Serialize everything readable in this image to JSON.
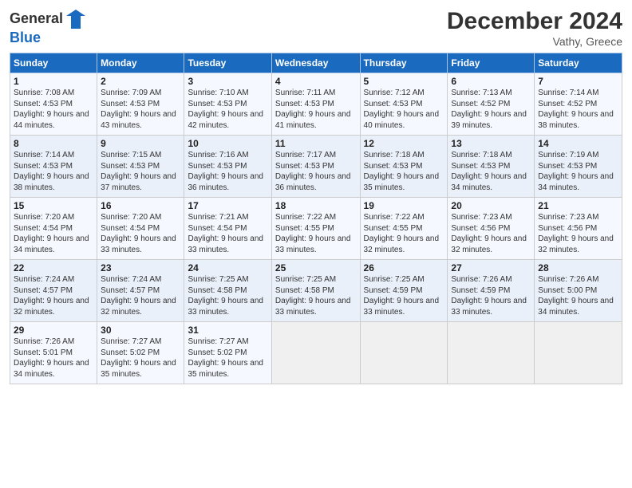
{
  "header": {
    "logo_line1": "General",
    "logo_line2": "Blue",
    "month_title": "December 2024",
    "location": "Vathy, Greece"
  },
  "weekdays": [
    "Sunday",
    "Monday",
    "Tuesday",
    "Wednesday",
    "Thursday",
    "Friday",
    "Saturday"
  ],
  "weeks": [
    [
      {
        "day": "1",
        "detail": "Sunrise: 7:08 AM\nSunset: 4:53 PM\nDaylight: 9 hours\nand 44 minutes."
      },
      {
        "day": "2",
        "detail": "Sunrise: 7:09 AM\nSunset: 4:53 PM\nDaylight: 9 hours\nand 43 minutes."
      },
      {
        "day": "3",
        "detail": "Sunrise: 7:10 AM\nSunset: 4:53 PM\nDaylight: 9 hours\nand 42 minutes."
      },
      {
        "day": "4",
        "detail": "Sunrise: 7:11 AM\nSunset: 4:53 PM\nDaylight: 9 hours\nand 41 minutes."
      },
      {
        "day": "5",
        "detail": "Sunrise: 7:12 AM\nSunset: 4:53 PM\nDaylight: 9 hours\nand 40 minutes."
      },
      {
        "day": "6",
        "detail": "Sunrise: 7:13 AM\nSunset: 4:52 PM\nDaylight: 9 hours\nand 39 minutes."
      },
      {
        "day": "7",
        "detail": "Sunrise: 7:14 AM\nSunset: 4:52 PM\nDaylight: 9 hours\nand 38 minutes."
      }
    ],
    [
      {
        "day": "8",
        "detail": "Sunrise: 7:14 AM\nSunset: 4:53 PM\nDaylight: 9 hours\nand 38 minutes."
      },
      {
        "day": "9",
        "detail": "Sunrise: 7:15 AM\nSunset: 4:53 PM\nDaylight: 9 hours\nand 37 minutes."
      },
      {
        "day": "10",
        "detail": "Sunrise: 7:16 AM\nSunset: 4:53 PM\nDaylight: 9 hours\nand 36 minutes."
      },
      {
        "day": "11",
        "detail": "Sunrise: 7:17 AM\nSunset: 4:53 PM\nDaylight: 9 hours\nand 36 minutes."
      },
      {
        "day": "12",
        "detail": "Sunrise: 7:18 AM\nSunset: 4:53 PM\nDaylight: 9 hours\nand 35 minutes."
      },
      {
        "day": "13",
        "detail": "Sunrise: 7:18 AM\nSunset: 4:53 PM\nDaylight: 9 hours\nand 34 minutes."
      },
      {
        "day": "14",
        "detail": "Sunrise: 7:19 AM\nSunset: 4:53 PM\nDaylight: 9 hours\nand 34 minutes."
      }
    ],
    [
      {
        "day": "15",
        "detail": "Sunrise: 7:20 AM\nSunset: 4:54 PM\nDaylight: 9 hours\nand 34 minutes."
      },
      {
        "day": "16",
        "detail": "Sunrise: 7:20 AM\nSunset: 4:54 PM\nDaylight: 9 hours\nand 33 minutes."
      },
      {
        "day": "17",
        "detail": "Sunrise: 7:21 AM\nSunset: 4:54 PM\nDaylight: 9 hours\nand 33 minutes."
      },
      {
        "day": "18",
        "detail": "Sunrise: 7:22 AM\nSunset: 4:55 PM\nDaylight: 9 hours\nand 33 minutes."
      },
      {
        "day": "19",
        "detail": "Sunrise: 7:22 AM\nSunset: 4:55 PM\nDaylight: 9 hours\nand 32 minutes."
      },
      {
        "day": "20",
        "detail": "Sunrise: 7:23 AM\nSunset: 4:56 PM\nDaylight: 9 hours\nand 32 minutes."
      },
      {
        "day": "21",
        "detail": "Sunrise: 7:23 AM\nSunset: 4:56 PM\nDaylight: 9 hours\nand 32 minutes."
      }
    ],
    [
      {
        "day": "22",
        "detail": "Sunrise: 7:24 AM\nSunset: 4:57 PM\nDaylight: 9 hours\nand 32 minutes."
      },
      {
        "day": "23",
        "detail": "Sunrise: 7:24 AM\nSunset: 4:57 PM\nDaylight: 9 hours\nand 32 minutes."
      },
      {
        "day": "24",
        "detail": "Sunrise: 7:25 AM\nSunset: 4:58 PM\nDaylight: 9 hours\nand 33 minutes."
      },
      {
        "day": "25",
        "detail": "Sunrise: 7:25 AM\nSunset: 4:58 PM\nDaylight: 9 hours\nand 33 minutes."
      },
      {
        "day": "26",
        "detail": "Sunrise: 7:25 AM\nSunset: 4:59 PM\nDaylight: 9 hours\nand 33 minutes."
      },
      {
        "day": "27",
        "detail": "Sunrise: 7:26 AM\nSunset: 4:59 PM\nDaylight: 9 hours\nand 33 minutes."
      },
      {
        "day": "28",
        "detail": "Sunrise: 7:26 AM\nSunset: 5:00 PM\nDaylight: 9 hours\nand 34 minutes."
      }
    ],
    [
      {
        "day": "29",
        "detail": "Sunrise: 7:26 AM\nSunset: 5:01 PM\nDaylight: 9 hours\nand 34 minutes."
      },
      {
        "day": "30",
        "detail": "Sunrise: 7:27 AM\nSunset: 5:02 PM\nDaylight: 9 hours\nand 35 minutes."
      },
      {
        "day": "31",
        "detail": "Sunrise: 7:27 AM\nSunset: 5:02 PM\nDaylight: 9 hours\nand 35 minutes."
      },
      null,
      null,
      null,
      null
    ]
  ]
}
